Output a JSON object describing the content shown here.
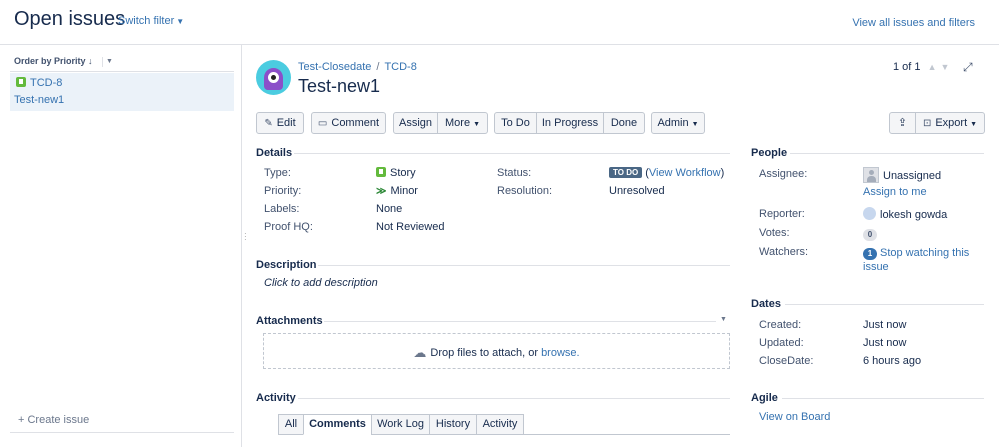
{
  "header": {
    "title": "Open issues",
    "switch_filter": "Switch filter",
    "view_all": "View all issues and filters"
  },
  "sidebar": {
    "order_label": "Order by Priority",
    "issue": {
      "key": "TCD-8",
      "summary": "Test-new1"
    },
    "create_issue": "+ Create issue"
  },
  "issue": {
    "project": "Test-Closedate",
    "key": "TCD-8",
    "title": "Test-new1",
    "pager": "1 of 1"
  },
  "toolbar": {
    "edit": "Edit",
    "comment": "Comment",
    "assign": "Assign",
    "more": "More",
    "to_do": "To Do",
    "in_progress": "In Progress",
    "done": "Done",
    "admin": "Admin",
    "export": "Export"
  },
  "details": {
    "heading": "Details",
    "type_label": "Type:",
    "type_value": "Story",
    "priority_label": "Priority:",
    "priority_value": "Minor",
    "labels_label": "Labels:",
    "labels_value": "None",
    "proof_label": "Proof HQ:",
    "proof_value": "Not Reviewed",
    "status_label": "Status:",
    "status_badge": "TO DO",
    "status_link": "View Workflow",
    "resolution_label": "Resolution:",
    "resolution_value": "Unresolved"
  },
  "description": {
    "heading": "Description",
    "placeholder": "Click to add description"
  },
  "attachments": {
    "heading": "Attachments",
    "drop_text": "Drop files to attach, or",
    "browse": "browse."
  },
  "activity": {
    "heading": "Activity",
    "tabs": [
      "All",
      "Comments",
      "Work Log",
      "History",
      "Activity"
    ],
    "active_tab": "Comments"
  },
  "people": {
    "heading": "People",
    "assignee_label": "Assignee:",
    "assignee_value": "Unassigned",
    "assign_to_me": "Assign to me",
    "reporter_label": "Reporter:",
    "reporter_value": "lokesh gowda",
    "votes_label": "Votes:",
    "votes_count": "0",
    "watchers_label": "Watchers:",
    "watchers_count": "1",
    "stop_watching_line1": "Stop watching this",
    "stop_watching_line2": "issue"
  },
  "dates": {
    "heading": "Dates",
    "created_label": "Created:",
    "created_value": "Just now",
    "updated_label": "Updated:",
    "updated_value": "Just now",
    "closedate_label": "CloseDate:",
    "closedate_value": "6 hours ago"
  },
  "agile": {
    "heading": "Agile",
    "view_on_board": "View on Board"
  },
  "colors": {
    "link": "#3572b0",
    "story_green": "#63ba3c",
    "todo_badge": "#4a6785"
  }
}
